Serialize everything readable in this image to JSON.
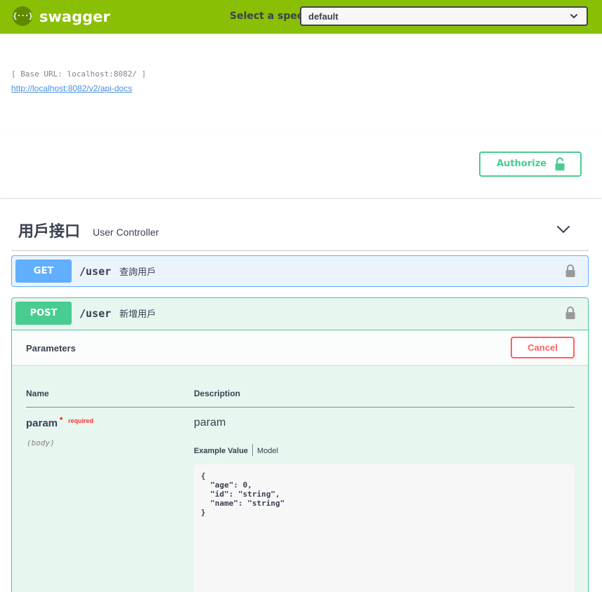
{
  "topbar": {
    "logo_text": "{···}",
    "brand": "swagger",
    "spec_label": "Select a spec",
    "spec_value": "default",
    "colors": {
      "background": "#89bf04",
      "logo_bg": "#5f8a00"
    }
  },
  "info": {
    "base_url": "[ Base URL: localhost:8082/ ]",
    "spec_link": "http://localhost:8082/v2/api-docs"
  },
  "auth": {
    "authorize_label": "Authorize",
    "icon": "unlocked-lock-icon",
    "color": "#49cc90"
  },
  "tag": {
    "name": "用戶接口",
    "description": "User Controller",
    "expanded": true
  },
  "operations": [
    {
      "method": "GET",
      "path": "/user",
      "summary": "查詢用戶",
      "color": "#61affe",
      "expanded": false
    },
    {
      "method": "POST",
      "path": "/user",
      "summary": "新增用戶",
      "color": "#49cc90",
      "expanded": true,
      "parameters_title": "Parameters",
      "cancel_label": "Cancel",
      "columns": [
        "Name",
        "Description"
      ],
      "param": {
        "name": "param",
        "required_marker": "*",
        "required_label": "required",
        "location": "(body)",
        "description": "param",
        "tabs": [
          "Example Value",
          "Model"
        ],
        "active_tab": "Example Value",
        "example": "{\n  \"age\": 0,\n  \"id\": \"string\",\n  \"name\": \"string\"\n}"
      }
    }
  ]
}
